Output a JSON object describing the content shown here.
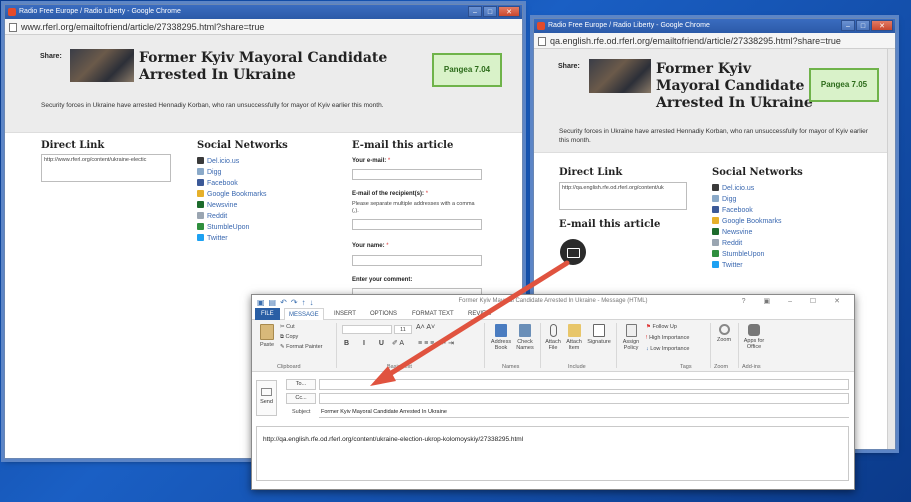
{
  "left_window": {
    "title": "Radio Free Europe / Radio Liberty - Google Chrome",
    "url": "www.rferl.org/emailtofriend/article/27338295.html?share=true",
    "share_label": "Share:",
    "headline": "Former Kyiv Mayoral Candidate Arrested In Ukraine",
    "summary": "Security forces in Ukraine have arrested Hennadiy Korban, who ran unsuccessfully for mayor of Kyiv earlier this month.",
    "pangea_badge": "Pangea 7.04",
    "direct_link": {
      "heading": "Direct Link",
      "value": "http://www.rferl.org/content/ukraine-electic"
    },
    "social": {
      "heading": "Social Networks",
      "items": [
        "Del.icio.us",
        "Digg",
        "Facebook",
        "Google Bookmarks",
        "Newsvine",
        "Reddit",
        "StumbleUpon",
        "Twitter"
      ]
    },
    "email": {
      "heading": "E-mail this article",
      "your_email_label": "Your e-mail:",
      "recipients_label": "E-mail of the recipient(s):",
      "recipients_note": "Please separate multiple addresses with a comma (,).",
      "your_name_label": "Your name:",
      "comment_label": "Enter your comment:",
      "required_mark": "*"
    }
  },
  "right_window": {
    "title": "Radio Free Europe / Radio Liberty - Google Chrome",
    "url": "qa.english.rfe.od.rferl.org/emailtofriend/article/27338295.html?share=true",
    "share_label": "Share:",
    "headline": "Former Kyiv Mayoral Candidate Arrested In Ukraine",
    "summary": "Security forces in Ukraine have arrested Hennadiy Korban, who ran unsuccessfully for mayor of Kyiv earlier this month.",
    "pangea_badge": "Pangea 7.05",
    "direct_link": {
      "heading": "Direct Link",
      "value": "http://qa.english.rfe.od.rferl.org/content/uk"
    },
    "email_heading": "E-mail this article",
    "social": {
      "heading": "Social Networks",
      "items": [
        "Del.icio.us",
        "Digg",
        "Facebook",
        "Google Bookmarks",
        "Newsvine",
        "Reddit",
        "StumbleUpon",
        "Twitter"
      ]
    }
  },
  "outlook": {
    "title": "Former Kyiv Mayoral Candidate Arrested In Ukraine - Message (HTML)",
    "window_controls": "? ▣ – ☐ ✕",
    "tabs": [
      "FILE",
      "MESSAGE",
      "INSERT",
      "OPTIONS",
      "FORMAT TEXT",
      "REVIEW"
    ],
    "active_tab": "MESSAGE",
    "ribbon": {
      "paste": "Paste",
      "cut": "Cut",
      "copy": "Copy",
      "format_painter": "Format Painter",
      "clipboard_group": "Clipboard",
      "basic_text_group": "Basic Text",
      "address_book": "Address Book",
      "check_names": "Check Names",
      "names_group": "Names",
      "attach_file": "Attach File",
      "attach_item": "Attach Item",
      "signature": "Signature",
      "include_group": "Include",
      "assign_policy": "Assign Policy",
      "follow_up": "Follow Up",
      "high_importance": "High Importance",
      "low_importance": "Low Importance",
      "tags_group": "Tags",
      "zoom": "Zoom",
      "zoom_group": "Zoom",
      "apps_for_office": "Apps for Office",
      "addins_group": "Add-ins",
      "font_size": "11"
    },
    "send_label": "Send",
    "to_label": "To...",
    "cc_label": "Cc...",
    "subject_label": "Subject",
    "subject_value": "Former Kyiv Mayoral Candidate Arrested In Ukraine",
    "body": "http://qa.english.rfe.od.rferl.org/content/ukraine-election-ukrop-kolomoyskiy/27338295.html"
  },
  "colors": {
    "desktop": "#1a5fc4",
    "pangea_bg": "#d9f2c9",
    "pangea_border": "#6fb34a",
    "arrow": "#e0533f",
    "link": "#3a68b0",
    "outlook_accent": "#2a5fa5"
  }
}
